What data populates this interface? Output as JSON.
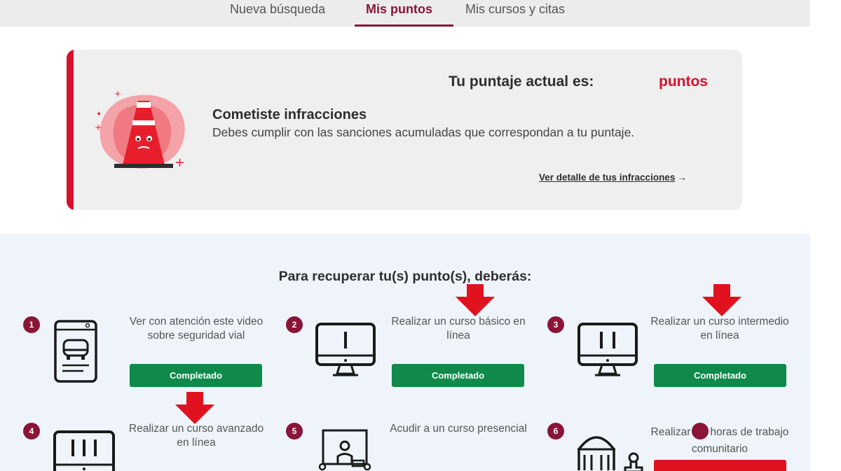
{
  "nav": {
    "tabs": [
      {
        "label": "Nueva búsqueda",
        "active": false
      },
      {
        "label": "Mis puntos",
        "active": true
      },
      {
        "label": "Mis cursos y citas",
        "active": false
      }
    ]
  },
  "status": {
    "score_label": "Tu puntaje actual es:",
    "score_unit": "puntos",
    "title": "Cometiste infracciones",
    "description": "Debes cumplir con las sanciones acumuladas que correspondan a tu puntaje.",
    "detail_link": "Ver detalle de tus infracciones",
    "detail_arrow": "→"
  },
  "recovery": {
    "title": "Para recuperar tu(s) punto(s), deberás:",
    "steps": [
      {
        "number": "1",
        "icon": "phone-video-car-icon",
        "text": "Ver con atención este video sobre seguridad vial",
        "button": "Completado"
      },
      {
        "number": "2",
        "icon": "monitor-basic-course-icon",
        "text": "Realizar un curso básico en línea",
        "button": "Completado"
      },
      {
        "number": "3",
        "icon": "monitor-intermediate-course-icon",
        "text": "Realizar un curso intermedio en línea",
        "button": "Completado"
      },
      {
        "number": "4",
        "icon": "monitor-advanced-course-icon",
        "text": "Realizar un curso avanzado en línea"
      },
      {
        "number": "5",
        "icon": "classroom-presenter-icon",
        "text": "Acudir a un curso presencial"
      },
      {
        "number": "6",
        "icon": "community-service-building-icon",
        "text_before": "Realizar",
        "text_after": "horas de trabajo comunitario"
      }
    ]
  },
  "colors": {
    "brand": "#8a1538",
    "alert_red": "#d6112d",
    "success_green": "#0f8a4a",
    "annotation_arrow": "#e0121f"
  }
}
